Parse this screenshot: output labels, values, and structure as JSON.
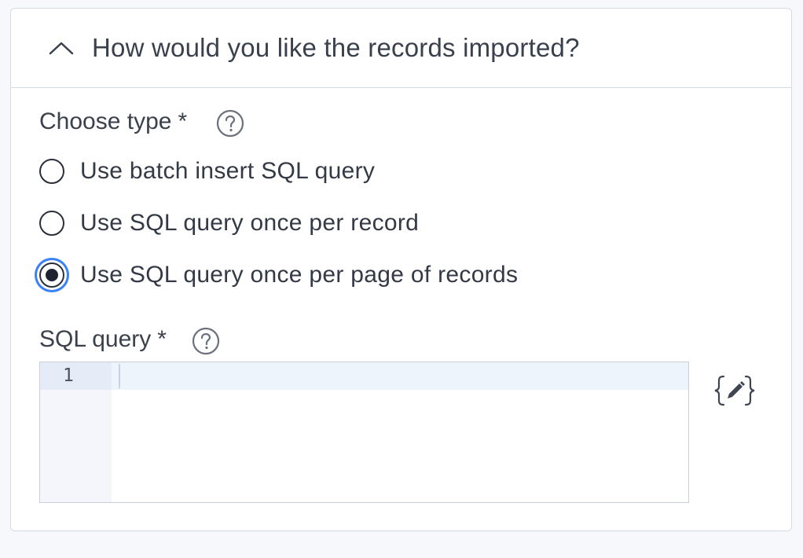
{
  "section": {
    "title": "How would you like the records imported?"
  },
  "type_field": {
    "label": "Choose type",
    "required_mark": "*",
    "options": [
      {
        "label": "Use batch insert SQL query",
        "selected": false
      },
      {
        "label": "Use SQL query once per record",
        "selected": false
      },
      {
        "label": "Use SQL query once per page of records",
        "selected": true
      }
    ]
  },
  "query_field": {
    "label": "SQL query",
    "required_mark": "*",
    "line_number": "1",
    "value": ""
  },
  "icons": {
    "collapse": "chevron-up-icon",
    "help": "question-circle-icon",
    "template": "curly-braces-pencil-icon"
  },
  "colors": {
    "focus_ring": "#3b82f6",
    "background": "#f7f8fc",
    "border": "#d5dbe5"
  }
}
